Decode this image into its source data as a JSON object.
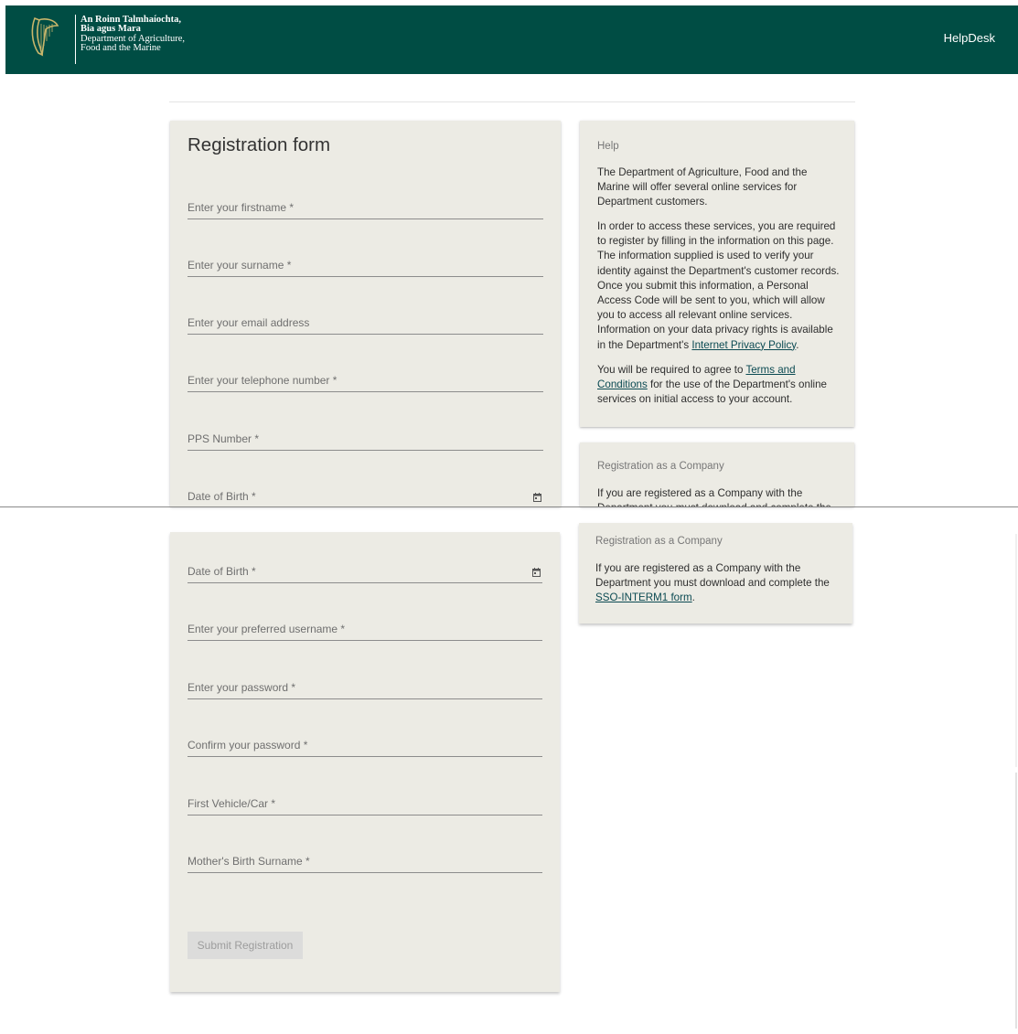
{
  "header": {
    "brand_line1": "An Roinn Talmhaíochta,",
    "brand_line2": "Bia agus Mara",
    "brand_line3": "Department of Agriculture,",
    "brand_line4": "Food and the Marine",
    "helpdesk_label": "HelpDesk",
    "logo_icon": "harp-icon",
    "color": "#004d44"
  },
  "form": {
    "title": "Registration form",
    "fields_part1": [
      "Enter your firstname *",
      "Enter your surname *",
      "Enter your email address",
      "Enter your telephone number *",
      "PPS Number *",
      "Date of Birth *"
    ],
    "fields_part2": [
      "Date of Birth *",
      "Enter your preferred username *",
      "Enter your password *",
      "Confirm your password *",
      "First Vehicle/Car *",
      "Mother's Birth Surname *"
    ],
    "submit_label": "Submit Registration",
    "calendar_icon": "calendar-icon"
  },
  "help": {
    "heading": "Help",
    "p1": "The Department of Agriculture, Food and the Marine will offer several online services for Department customers.",
    "p2_text": "In order to access these services, you are required to register by filling in the information on this page. The information supplied is used to verify your identity against the Department's customer records. Once you submit this information, a Personal Access Code will be sent to you, which will allow you to access all relevant online services. Information on your data privacy rights is available in the Department's ",
    "p2_link": "Internet Privacy Policy",
    "p2_end": ".",
    "p3_pre": "You will be required to agree to ",
    "p3_link": "Terms and Conditions",
    "p3_post": " for the use of the Department's online services on initial access to your account."
  },
  "company": {
    "heading": "Registration as a Company",
    "text_pre": "If you are registered as a Company with the Department you must download and complete the ",
    "link": "SSO-INTERM1 form",
    "text_post": "."
  },
  "colors": {
    "card_bg": "#ecebe4",
    "link": "#0b4a52"
  }
}
